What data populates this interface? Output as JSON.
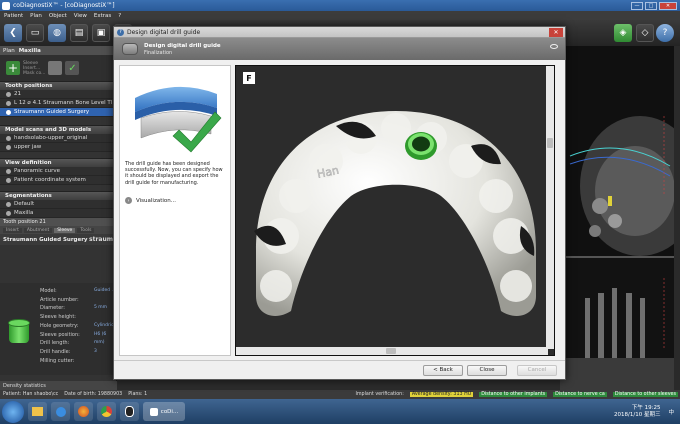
{
  "window": {
    "title": "coDiagnostiX™ - [coDiagnostiX™]",
    "minimize": "—",
    "maximize": "□",
    "close": "✕"
  },
  "menu": [
    "Patient",
    "Plan",
    "Object",
    "View",
    "Extras",
    "?"
  ],
  "left_panel": {
    "plan_header": "Plan",
    "plan_name": "Maxilla",
    "plan_tools_list": [
      "Sleeve",
      "Insert...",
      "Mask co..."
    ],
    "tooth_positions_header": "Tooth positions",
    "tooth_group": "21",
    "tooth_items": [
      "L 12  ⌀ 4.1   Straumann Bone Level Tl",
      "Straumann Guided Surgery"
    ],
    "models_header": "Model scans and 3D models",
    "models": [
      "handsolabo-upper_original",
      "upper jaw"
    ],
    "view_def_header": "View definition",
    "view_defs": [
      "Panoramic curve",
      "Patient coordinate system"
    ],
    "segmentations_header": "Segmentations",
    "segmentations": [
      "Default",
      "Maxilla"
    ],
    "position_header": "Tooth position 21",
    "subtabs": [
      "Insert",
      "Abutment",
      "Sleeve",
      "Tools"
    ],
    "sgs_title": "Straumann Guided Surgery",
    "sgs_logo": "straum",
    "props": [
      "Model:",
      "Article number:",
      "Diameter:",
      "Sleeve height:",
      "Hole geometry:",
      "Sleeve position:",
      "Drill length:",
      "Drill handle:",
      "Milling cutter:"
    ],
    "prop_values": [
      "Guided ...",
      "",
      "5 mm",
      "",
      "Cylindric...",
      "H6 (6 mm)",
      "3",
      "",
      ""
    ],
    "density_label": "Density statistics"
  },
  "dialog": {
    "title": "Design digital drill guide",
    "header_title": "Design digital drill guide",
    "header_subtitle": "Finalization",
    "message": "The drill guide has been designed successfully. Now, you can specify how it should be displayed and export the drill guide for manufacturing.",
    "visualization": "Visualization...",
    "view_badge": "F",
    "model_engraving": "Han",
    "buttons": {
      "back": "< Back",
      "close": "Close",
      "cancel": "Cancel"
    }
  },
  "statusbar": {
    "patient": "Patient: Han shaobo\\cc",
    "dob": "Date of birth: 19880903",
    "plans": "Plans: 1",
    "implant_verification": "Implant verification:",
    "avg_density": "Average density: 313 HU",
    "dist_implants": "Distance to other implants",
    "dist_nerve": "Distance to nerve ca",
    "dist_sleeves": "Distance to other sleeves"
  },
  "taskbar": {
    "app_label": "coDi...",
    "lang": "中",
    "time": "下午 19:25",
    "date": "2018/1/10 星期三"
  }
}
